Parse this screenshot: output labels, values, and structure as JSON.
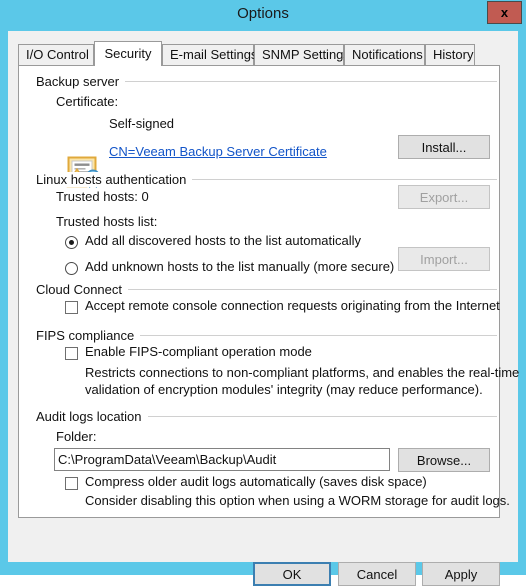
{
  "window": {
    "title": "Options",
    "close_label": "x",
    "frame_color": "#5BC8E8",
    "dialog_bg": "#F0F0F0"
  },
  "tabs": [
    {
      "label": "I/O Control",
      "active": false
    },
    {
      "label": "Security",
      "active": true
    },
    {
      "label": "E-mail Settings",
      "active": false
    },
    {
      "label": "SNMP Settings",
      "active": false
    },
    {
      "label": "Notifications",
      "active": false
    },
    {
      "label": "History",
      "active": false
    }
  ],
  "groups": {
    "backup_server": {
      "title": "Backup server",
      "certificate_label": "Certificate:",
      "certificate_kind": "Self-signed",
      "certificate_link": "CN=Veeam Backup Server Certificate",
      "install_button": "Install...",
      "icon": "certificate-warning-icon"
    },
    "linux_hosts": {
      "title": "Linux hosts authentication",
      "trusted_hosts_count_label": "Trusted hosts: 0",
      "trusted_hosts_list_label": "Trusted hosts list:",
      "export_button": "Export...",
      "import_button": "Import...",
      "export_enabled": false,
      "import_enabled": false,
      "options": [
        {
          "label": "Add all discovered hosts to the list automatically",
          "checked": true
        },
        {
          "label": "Add unknown hosts to the list manually (more secure)",
          "checked": false
        }
      ]
    },
    "cloud_connect": {
      "title": "Cloud Connect",
      "accept_remote_label": "Accept remote console connection requests originating from the Internet",
      "accept_remote_checked": false
    },
    "fips": {
      "title": "FIPS compliance",
      "enable_label": "Enable FIPS-compliant operation mode",
      "enable_checked": false,
      "description_line1": "Restricts connections to non-compliant platforms, and enables the real-time",
      "description_line2": "validation of encryption modules' integrity (may reduce performance)."
    },
    "audit_logs": {
      "title": "Audit logs location",
      "folder_label": "Folder:",
      "folder_value": "C:\\ProgramData\\Veeam\\Backup\\Audit",
      "browse_button": "Browse...",
      "compress_label": "Compress older audit logs automatically (saves disk space)",
      "compress_checked": false,
      "compress_hint": "Consider disabling this option when using a WORM storage for audit logs."
    }
  },
  "footer": {
    "ok_label": "OK",
    "cancel_label": "Cancel",
    "apply_label": "Apply"
  }
}
